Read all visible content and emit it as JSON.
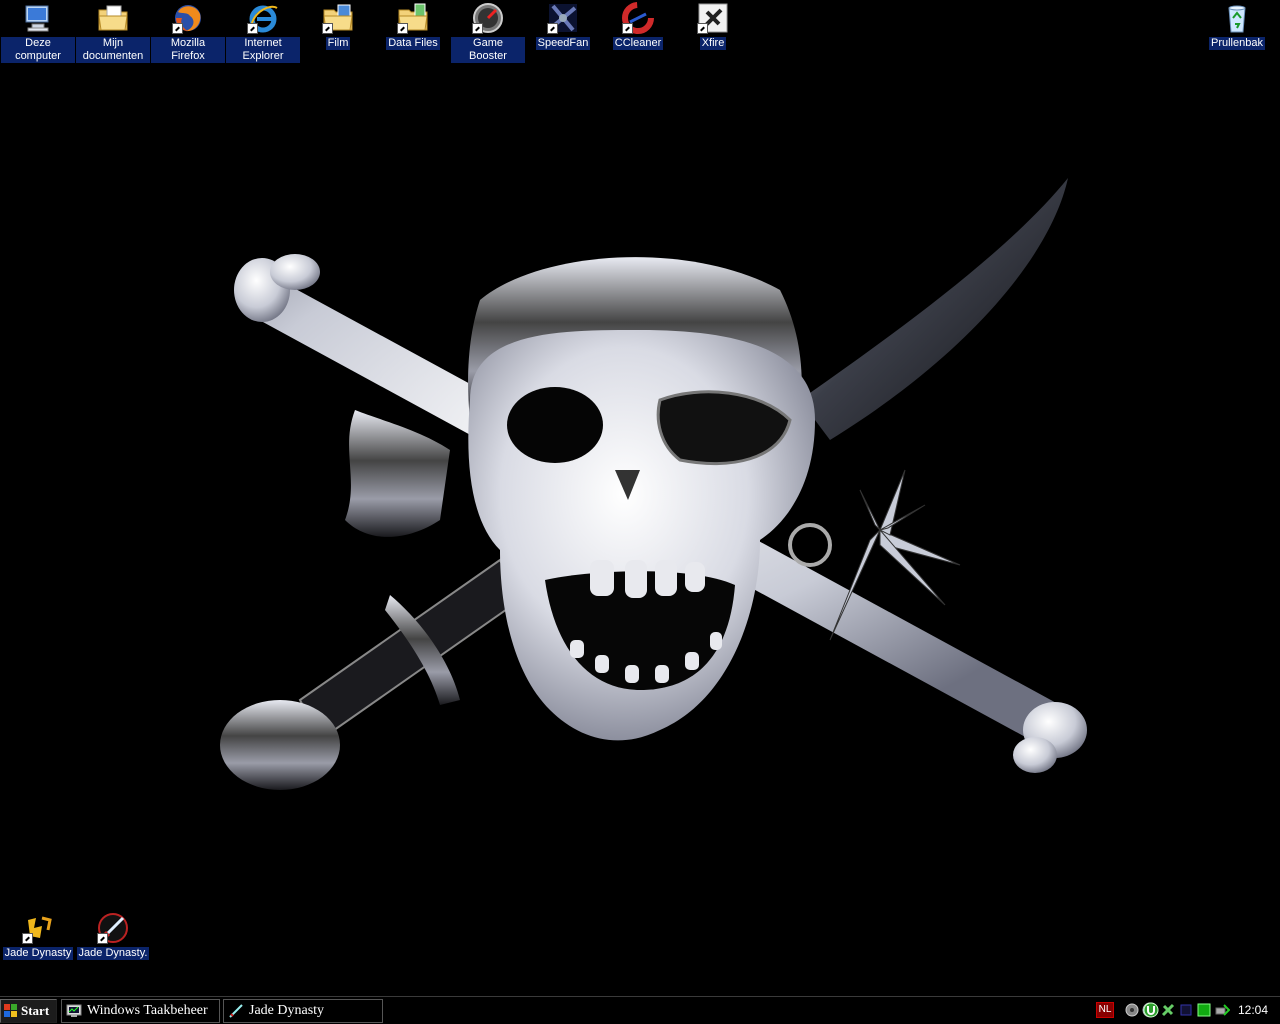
{
  "desktop": {
    "wallpaper": "pirate-skull-crossbones-wallpaper",
    "icons_top": [
      {
        "label": "Deze computer",
        "icon": "my-computer-icon",
        "shortcut": false
      },
      {
        "label": "Mijn documenten",
        "icon": "my-documents-folder-icon",
        "shortcut": false
      },
      {
        "label": "Mozilla Firefox",
        "icon": "firefox-icon",
        "shortcut": true
      },
      {
        "label": "Internet Explorer",
        "icon": "internet-explorer-icon",
        "shortcut": true
      },
      {
        "label": "Film",
        "icon": "folder-film-icon",
        "shortcut": true
      },
      {
        "label": "Data Files",
        "icon": "folder-data-icon",
        "shortcut": true
      },
      {
        "label": "Game Booster",
        "icon": "game-booster-icon",
        "shortcut": true
      },
      {
        "label": "SpeedFan",
        "icon": "speedfan-icon",
        "shortcut": true
      },
      {
        "label": "CCleaner",
        "icon": "ccleaner-icon",
        "shortcut": true
      },
      {
        "label": "Xfire",
        "icon": "xfire-icon",
        "shortcut": true
      }
    ],
    "recycle_bin": {
      "label": "Prullenbak",
      "icon": "recycle-bin-icon"
    },
    "icons_bottom": [
      {
        "label": "Jade Dynasty",
        "icon": "jade-dynasty-icon",
        "shortcut": true
      },
      {
        "label": "Jade Dynasty.",
        "icon": "jade-dynasty-sword-icon",
        "shortcut": true
      }
    ]
  },
  "taskbar": {
    "start_label": "Start",
    "tasks": [
      {
        "label": "Windows Taakbeheer",
        "icon": "task-manager-icon"
      },
      {
        "label": "Jade Dynasty",
        "icon": "jade-dynasty-task-icon"
      }
    ],
    "language": "NL",
    "tray_icons": [
      "speaker-icon",
      "network-globe-icon",
      "utorrent-icon",
      "xfire-tray-icon",
      "monitor-icon",
      "green-status-icon",
      "safely-remove-icon"
    ],
    "clock": "12:04"
  }
}
